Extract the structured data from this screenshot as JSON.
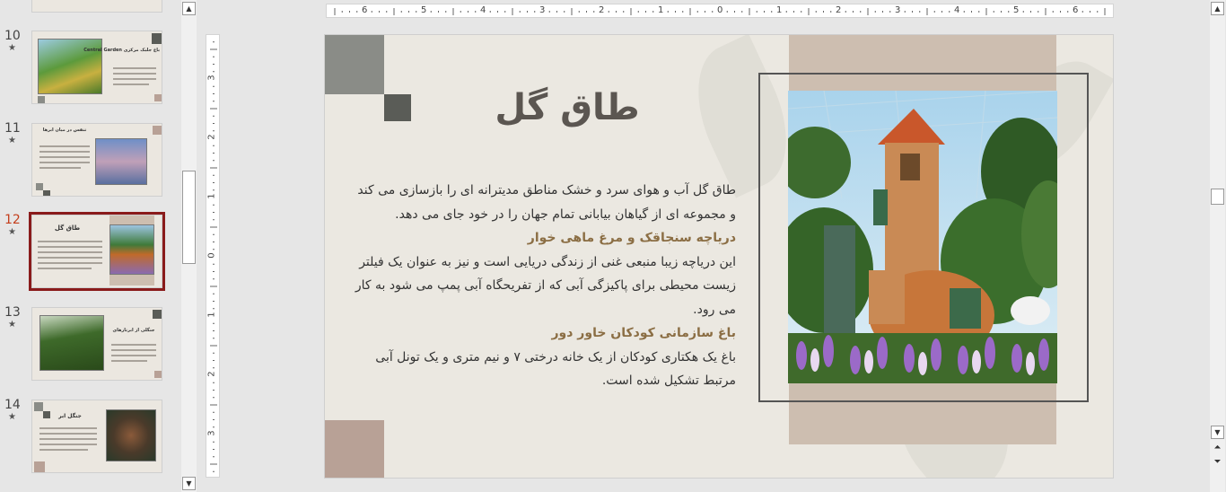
{
  "thumbnails": [
    {
      "number": "10",
      "title": "باغ جلبک مرکزی Central Garden",
      "star": "★"
    },
    {
      "number": "11",
      "title": "تنفس در میان ابرها",
      "star": "★"
    },
    {
      "number": "12",
      "title": "طاق گل",
      "star": "★",
      "active": true
    },
    {
      "number": "13",
      "title": "جنگلی از ابرتارهای",
      "star": "★"
    },
    {
      "number": "14",
      "title": "جنگل ابر",
      "star": "★"
    }
  ],
  "hruler": {
    "labels": [
      "6",
      "5",
      "4",
      "3",
      "2",
      "1",
      "0",
      "1",
      "2",
      "3",
      "4",
      "5",
      "6"
    ]
  },
  "vruler": {
    "labels": [
      "3",
      "2",
      "1",
      "0",
      "1",
      "2",
      "3"
    ]
  },
  "slide": {
    "title": "طاق گل",
    "p1": "طاق گل آب و هوای سرد و خشک مناطق مدیترانه ای را بازسازی می کند و مجموعه ای از گیاهان بیابانی تمام جهان را در خود جای می دهد.",
    "h1": "دریاچه سنجاقک و مرغ ماهی خوار",
    "p2": "این دریاچه زیبا منبعی غنی از زندگی دریایی است و نیز به عنوان یک فیلتر زیست محیطی برای پاکیزگی آبی که از تفریحگاه آبی پمپ می شود به کار می رود.",
    "h2": "باغ سازمانی کودکان خاور دور",
    "p3": "باغ یک هکتاری کودکان از یک خانه درختی ۷ و نیم متری و یک تونل آبی مرتبط تشکیل شده است.",
    "photo_icon": "flower-dome-house-photo"
  },
  "colors": {
    "slide_bg": "#ebe8e1",
    "title": "#5b5651",
    "highlight": "#8b6e44",
    "accent_active": "#c43e1c",
    "square_dark": "#5a5c57",
    "square_gray": "#8a8c87",
    "square_rose": "#b8a196",
    "photo_bg": "#cdbeb0"
  }
}
